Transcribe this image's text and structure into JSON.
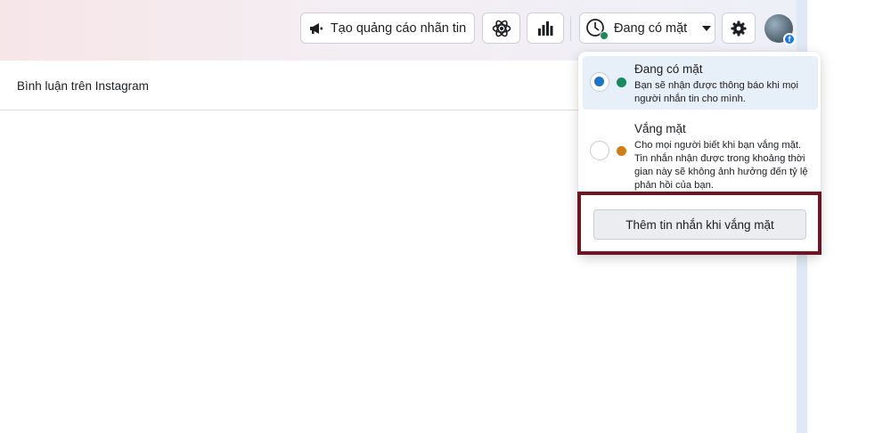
{
  "toolbar": {
    "ads_button_label": "Tạo quảng cáo nhãn tin",
    "ads_icon": "megaphone-icon",
    "atom_icon": "atom-icon",
    "stats_icon": "bar-chart-icon",
    "status_label": "Đang có mặt",
    "status_icon": "clock-status-icon",
    "settings_icon": "gear-icon",
    "avatar_badge": "f"
  },
  "page": {
    "section_label": "Bình luận trên Instagram"
  },
  "status_menu": {
    "options": [
      {
        "title": "Đang có mặt",
        "description": "Bạn sẽ nhận được thông báo khi mọi người nhắn tin cho mình.",
        "selected": true,
        "dot_color": "#1a8a5c"
      },
      {
        "title": "Vắng mặt",
        "description": "Cho mọi người biết khi bạn vắng mặt. Tin nhắn nhận được trong khoảng thời gian này sẽ không ảnh hưởng đến tỷ lệ phản hồi của bạn.",
        "selected": false,
        "dot_color": "#d17e14"
      }
    ],
    "away_message_button": "Thêm tin nhắn khi vắng mặt"
  },
  "colors": {
    "selected_radio": "#1a74c9",
    "highlight_border": "#6e1422",
    "facebook_blue": "#1877f2"
  }
}
